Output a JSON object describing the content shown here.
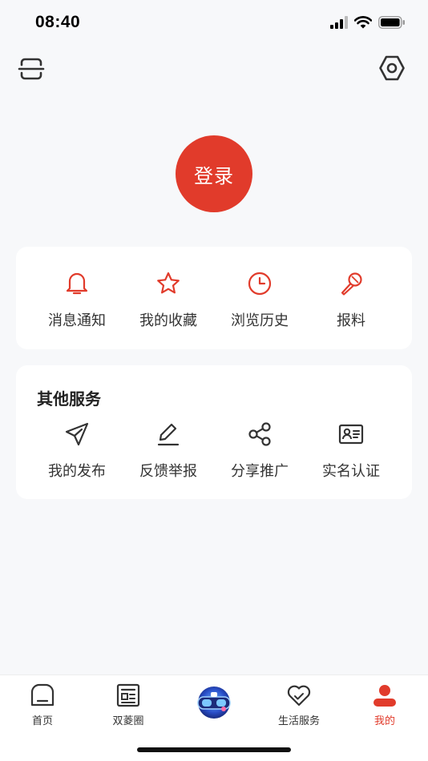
{
  "status_bar": {
    "time": "08:40"
  },
  "login": {
    "label": "登录"
  },
  "quick_actions": [
    {
      "label": "消息通知",
      "icon": "bell-icon"
    },
    {
      "label": "我的收藏",
      "icon": "star-icon"
    },
    {
      "label": "浏览历史",
      "icon": "clock-icon"
    },
    {
      "label": "报料",
      "icon": "microphone-icon"
    }
  ],
  "other_services": {
    "title": "其他服务",
    "items": [
      {
        "label": "我的发布",
        "icon": "send-icon"
      },
      {
        "label": "反馈举报",
        "icon": "edit-icon"
      },
      {
        "label": "分享推广",
        "icon": "share-icon"
      },
      {
        "label": "实名认证",
        "icon": "id-card-icon"
      }
    ]
  },
  "tab_bar": {
    "tabs": [
      {
        "label": "首页",
        "icon": "home-icon"
      },
      {
        "label": "双菱圈",
        "icon": "news-icon"
      },
      {
        "label": "",
        "icon": "vr-goggles-icon"
      },
      {
        "label": "生活服务",
        "icon": "heart-icon"
      },
      {
        "label": "我的",
        "icon": "user-icon",
        "active": true
      }
    ]
  },
  "colors": {
    "accent": "#e13b2b",
    "background": "#f7f8fa",
    "card": "#ffffff",
    "text": "#333333"
  }
}
